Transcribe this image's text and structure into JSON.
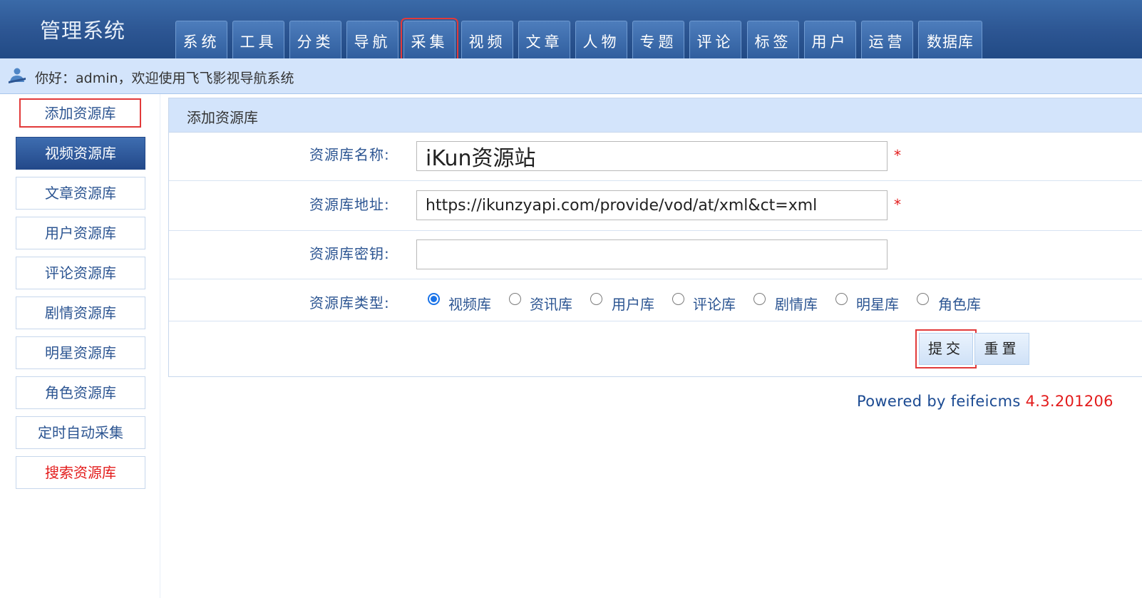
{
  "app": {
    "logo": "管理系统",
    "welcome": "你好：admin，欢迎使用飞飞影视导航系统"
  },
  "nav": {
    "tabs": [
      {
        "label": "系统",
        "active": false
      },
      {
        "label": "工具",
        "active": false
      },
      {
        "label": "分类",
        "active": false
      },
      {
        "label": "导航",
        "active": false
      },
      {
        "label": "采集",
        "active": true
      },
      {
        "label": "视频",
        "active": false
      },
      {
        "label": "文章",
        "active": false
      },
      {
        "label": "人物",
        "active": false
      },
      {
        "label": "专题",
        "active": false
      },
      {
        "label": "评论",
        "active": false
      },
      {
        "label": "标签",
        "active": false
      },
      {
        "label": "用户",
        "active": false
      },
      {
        "label": "运营",
        "active": false
      },
      {
        "label": "数据库",
        "active": false
      }
    ]
  },
  "sidebar": {
    "items": [
      {
        "label": "添加资源库"
      },
      {
        "label": "视频资源库"
      },
      {
        "label": "文章资源库"
      },
      {
        "label": "用户资源库"
      },
      {
        "label": "评论资源库"
      },
      {
        "label": "剧情资源库"
      },
      {
        "label": "明星资源库"
      },
      {
        "label": "角色资源库"
      },
      {
        "label": "定时自动采集"
      },
      {
        "label": "搜索资源库"
      }
    ]
  },
  "form": {
    "title": "添加资源库",
    "name": {
      "label": "资源库名称:",
      "value": "iKun资源站",
      "required": "*"
    },
    "url": {
      "label": "资源库地址:",
      "value": "https://ikunzyapi.com/provide/vod/at/xml&ct=xml",
      "required": "*"
    },
    "key": {
      "label": "资源库密钥:",
      "value": ""
    },
    "type": {
      "label": "资源库类型:",
      "options": [
        "视频库",
        "资讯库",
        "用户库",
        "评论库",
        "剧情库",
        "明星库",
        "角色库"
      ],
      "selected": "视频库"
    },
    "submit_label": "提交",
    "reset_label": "重置"
  },
  "footer": {
    "text": "Powered by feifeicms ",
    "version": "4.3.201206"
  },
  "colors": {
    "header_bg": "#2c5592",
    "accent_blue": "#2c5592",
    "highlight_red": "#e23a3a",
    "required_red": "#e31c1c"
  }
}
